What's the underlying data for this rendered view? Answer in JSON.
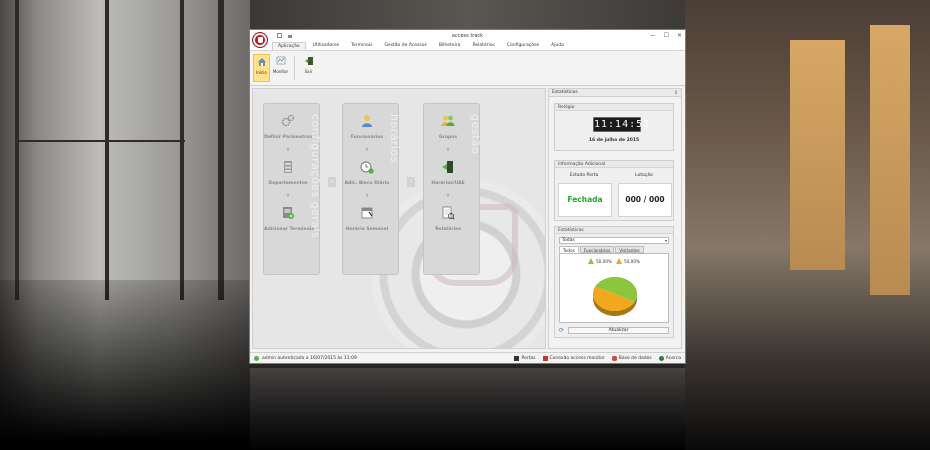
{
  "window": {
    "title": "access track",
    "controls": [
      "—",
      "☐",
      "✕"
    ]
  },
  "menu": {
    "tabs": [
      "Aplicação",
      "Utilizadores",
      "Terminais",
      "Gestão de Acessos",
      "Bilheteira",
      "Relatórios",
      "Configurações",
      "Ajuda"
    ],
    "active": "Aplicação"
  },
  "ribbon": {
    "buttons": [
      {
        "label": "Início",
        "icon": "home-icon"
      },
      {
        "label": "Monitor",
        "icon": "monitor-icon"
      },
      {
        "label": "Sair",
        "icon": "exit-icon"
      }
    ]
  },
  "dashboard": {
    "groups": [
      {
        "title": "configurações gerais",
        "items": [
          {
            "label": "Definir Parâmetros",
            "icon": "gears-icon"
          },
          {
            "label": "Departamentos",
            "icon": "cabinet-icon"
          },
          {
            "label": "Adicionar Terminais",
            "icon": "terminal-add-icon"
          }
        ]
      },
      {
        "title": "horários",
        "items": [
          {
            "label": "Funcionários",
            "icon": "user-icon"
          },
          {
            "label": "Adic. Bloco Diário",
            "icon": "clock-add-icon"
          },
          {
            "label": "Horário Semanal",
            "icon": "calendar-icon"
          }
        ]
      },
      {
        "title": "gestão",
        "items": [
          {
            "label": "Grupos",
            "icon": "users-icon"
          },
          {
            "label": "Horários/UAE",
            "icon": "door-icon"
          },
          {
            "label": "Relatórios",
            "icon": "reports-icon"
          }
        ]
      }
    ]
  },
  "side": {
    "header": "Estatísticas",
    "relogio": {
      "title": "Relógio",
      "time": "11:14:52",
      "date": "16 de julho de 2015"
    },
    "info": {
      "title": "Informação Adicional",
      "door_label": "Estado Porta",
      "door_value": "Fechada",
      "capacity_label": "Lotação",
      "capacity_value": "000 /  000"
    },
    "stats": {
      "title": "Estatísticas",
      "select_value": "Todas",
      "tabs": [
        "Todos",
        "Funcionários",
        "Visitantes"
      ],
      "active_tab": "Todos",
      "refresh_label": "Atualizar"
    }
  },
  "chart_data": {
    "type": "pie",
    "categories": [
      "",
      ""
    ],
    "values": [
      50,
      50
    ],
    "labels": [
      "50,00%",
      "50,00%"
    ],
    "colors": [
      "#8cc63f",
      "#f2a81d"
    ]
  },
  "status": {
    "user_text": "admin  autenticado a  16/07/2015 às 11:09",
    "items": [
      {
        "label": "Portas",
        "icon": "door-status-icon"
      },
      {
        "label": "Conexão access monitor",
        "icon": "plug-icon"
      },
      {
        "label": "Base de dados",
        "icon": "database-icon"
      },
      {
        "label": "Acerca",
        "icon": "about-icon"
      }
    ]
  }
}
